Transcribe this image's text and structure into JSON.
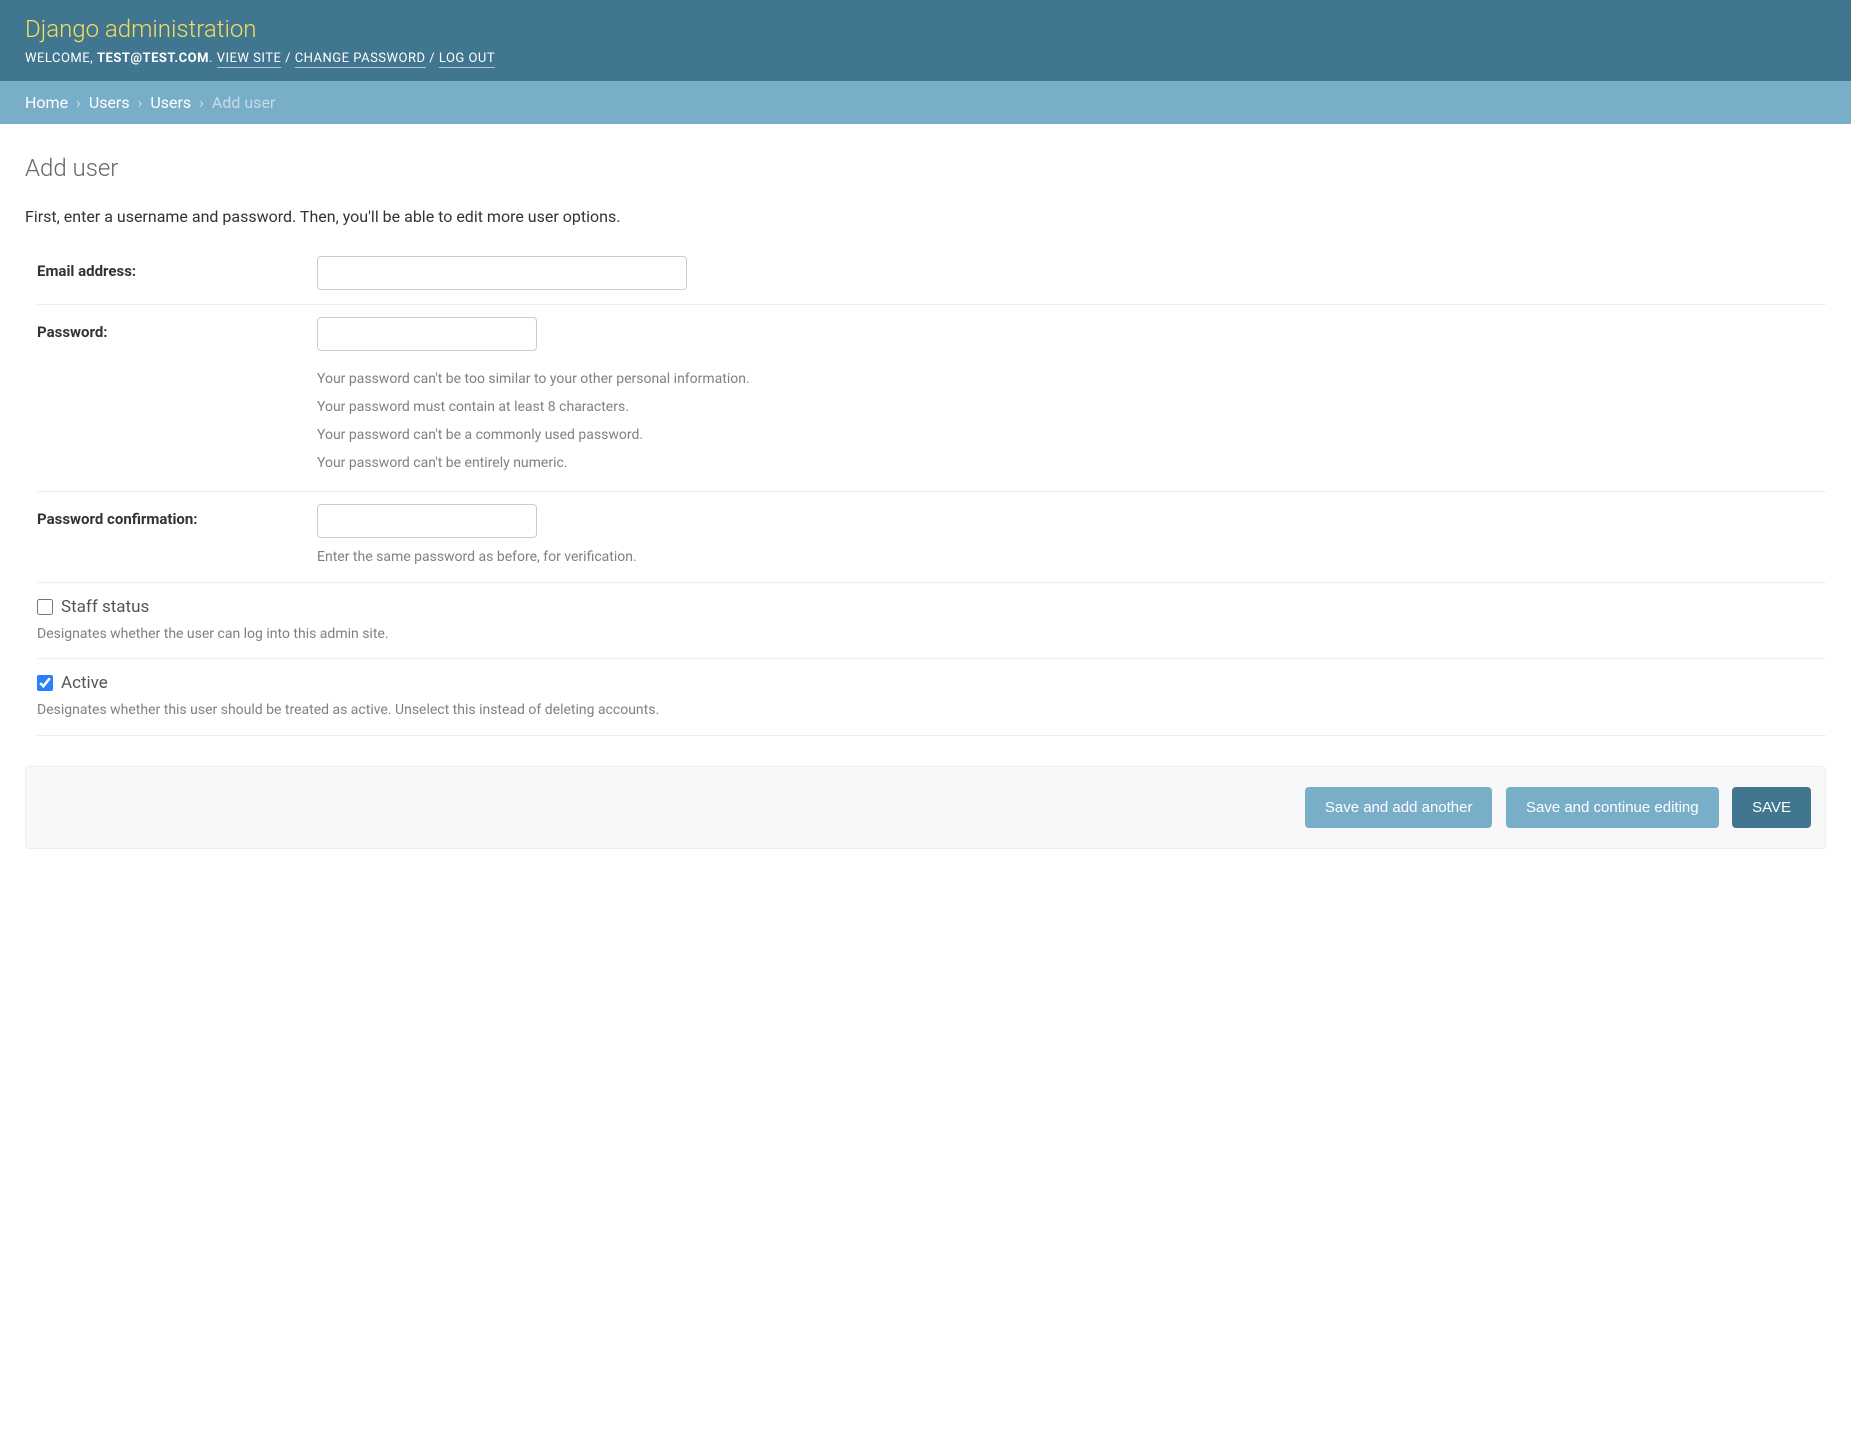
{
  "header": {
    "site_title": "Django administration",
    "welcome_label": "WELCOME,",
    "username": "TEST@TEST.COM",
    "links": {
      "view_site": "VIEW SITE",
      "change_password": "CHANGE PASSWORD",
      "log_out": "LOG OUT"
    },
    "separator": "/"
  },
  "breadcrumbs": {
    "items": [
      "Home",
      "Users",
      "Users"
    ],
    "current": "Add user",
    "separator": "›"
  },
  "page": {
    "title": "Add user",
    "intro": "First, enter a username and password. Then, you'll be able to edit more user options."
  },
  "form": {
    "email": {
      "label": "Email address:",
      "value": ""
    },
    "password": {
      "label": "Password:",
      "value": "",
      "help": [
        "Your password can't be too similar to your other personal information.",
        "Your password must contain at least 8 characters.",
        "Your password can't be a commonly used password.",
        "Your password can't be entirely numeric."
      ]
    },
    "password_confirm": {
      "label": "Password confirmation:",
      "value": "",
      "help": "Enter the same password as before, for verification."
    },
    "staff_status": {
      "label": "Staff status",
      "checked": false,
      "help": "Designates whether the user can log into this admin site."
    },
    "active": {
      "label": "Active",
      "checked": true,
      "help": "Designates whether this user should be treated as active. Unselect this instead of deleting accounts."
    }
  },
  "buttons": {
    "save_add_another": "Save and add another",
    "save_continue": "Save and continue editing",
    "save": "SAVE"
  }
}
